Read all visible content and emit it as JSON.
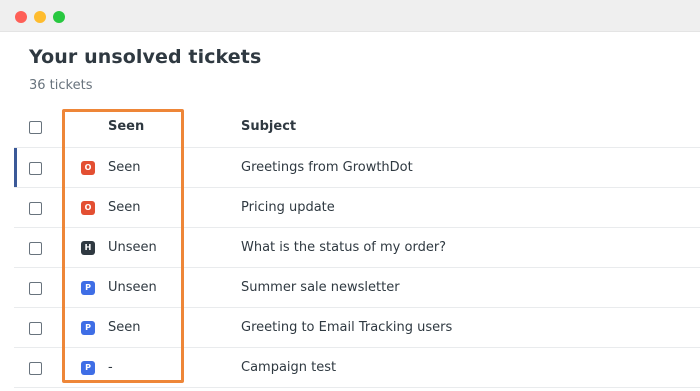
{
  "window": {
    "controls": [
      "close",
      "minimize",
      "maximize"
    ]
  },
  "header": {
    "title": "Your unsolved tickets",
    "count_label": "36 tickets"
  },
  "table": {
    "columns": {
      "seen": "Seen",
      "subject": "Subject"
    },
    "rows": [
      {
        "status_letter": "O",
        "status_color": "#e34f32",
        "seen": "Seen",
        "subject": "Greetings from GrowthDot"
      },
      {
        "status_letter": "O",
        "status_color": "#e34f32",
        "seen": "Seen",
        "subject": "Pricing update"
      },
      {
        "status_letter": "H",
        "status_color": "#2f3941",
        "seen": "Unseen",
        "subject": "What is the status of my order?"
      },
      {
        "status_letter": "P",
        "status_color": "#3f6ee6",
        "seen": "Unseen",
        "subject": "Summer sale newsletter"
      },
      {
        "status_letter": "P",
        "status_color": "#3f6ee6",
        "seen": "Seen",
        "subject": "Greeting to Email Tracking users"
      },
      {
        "status_letter": "P",
        "status_color": "#3f6ee6",
        "seen": "-",
        "subject": "Campaign test"
      }
    ]
  },
  "colors": {
    "highlight": "#ee8638",
    "row_selected_indicator": "#3b5998"
  }
}
